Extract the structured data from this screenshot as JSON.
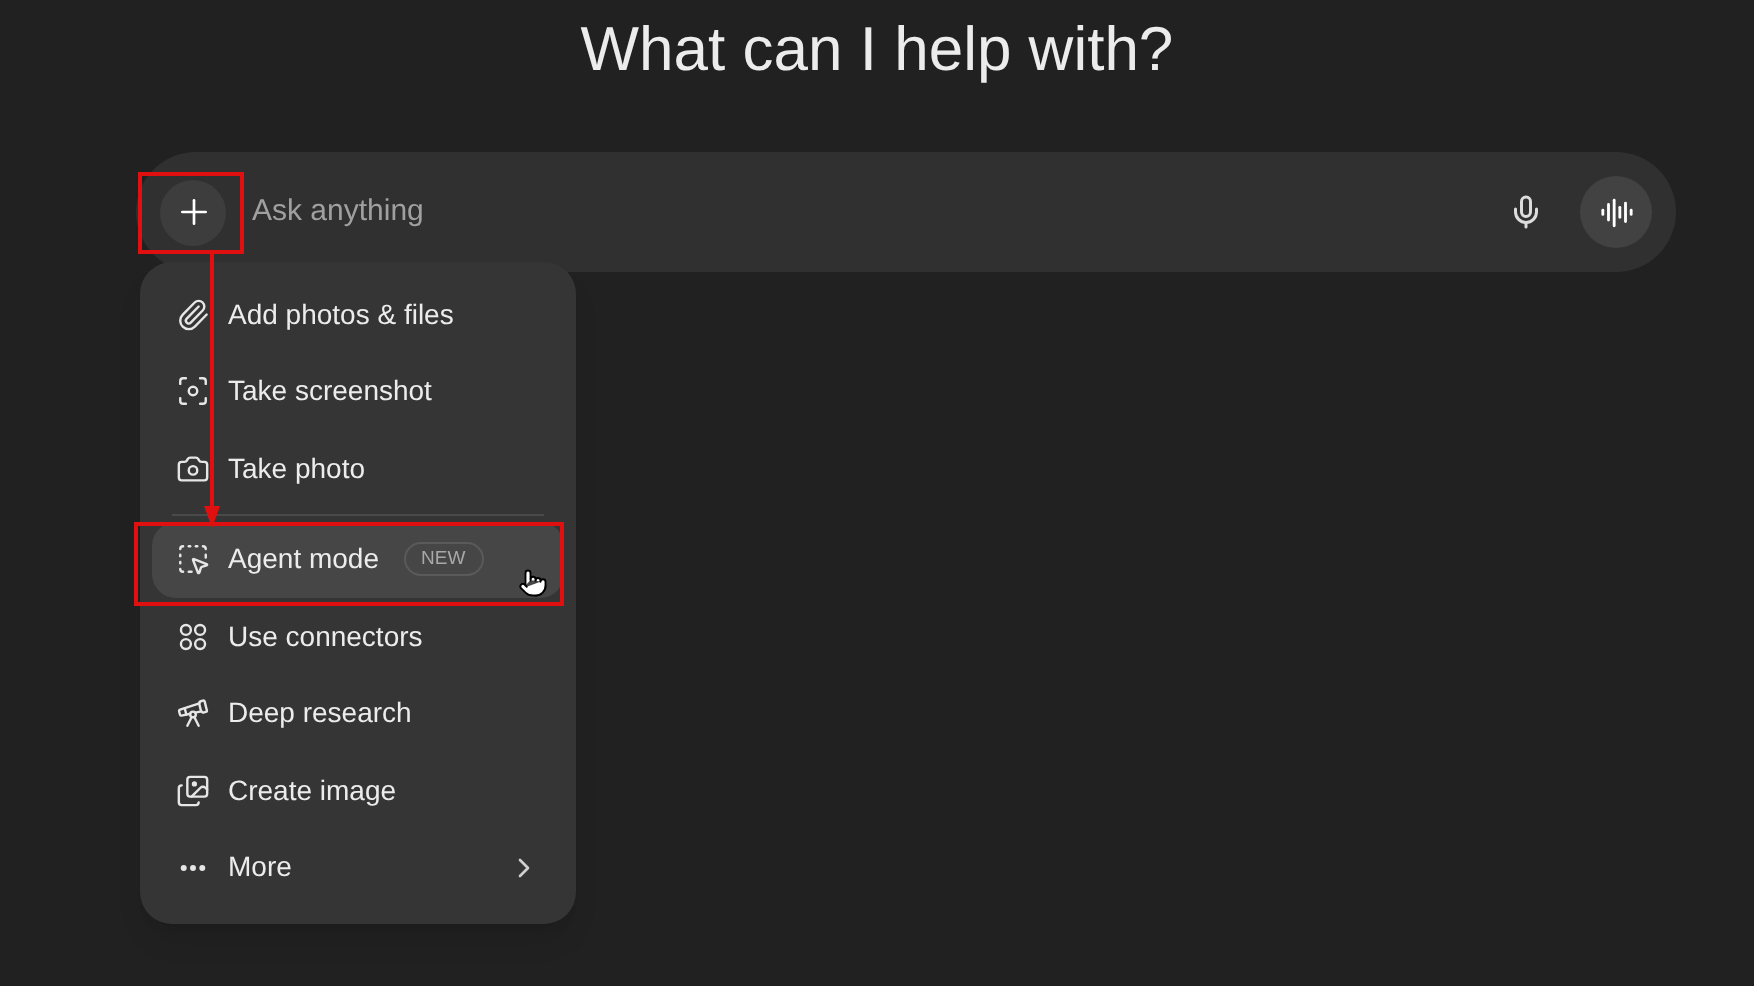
{
  "heading": "What can I help with?",
  "composer": {
    "placeholder": "Ask anything"
  },
  "menu": {
    "groups": [
      [
        {
          "kind": "attach",
          "label": "Add photos & files",
          "selected": false,
          "has_submenu": false
        },
        {
          "kind": "screenshot",
          "label": "Take screenshot",
          "selected": false,
          "has_submenu": false
        },
        {
          "kind": "photo",
          "label": "Take photo",
          "selected": false,
          "has_submenu": false
        }
      ],
      [
        {
          "kind": "agent",
          "label": "Agent mode",
          "badge": "NEW",
          "selected": true,
          "has_submenu": false
        },
        {
          "kind": "connectors",
          "label": "Use connectors",
          "selected": false,
          "has_submenu": false
        },
        {
          "kind": "research",
          "label": "Deep research",
          "selected": false,
          "has_submenu": false
        },
        {
          "kind": "image",
          "label": "Create image",
          "selected": false,
          "has_submenu": false
        },
        {
          "kind": "more",
          "label": "More",
          "selected": false,
          "has_submenu": true
        }
      ]
    ]
  }
}
